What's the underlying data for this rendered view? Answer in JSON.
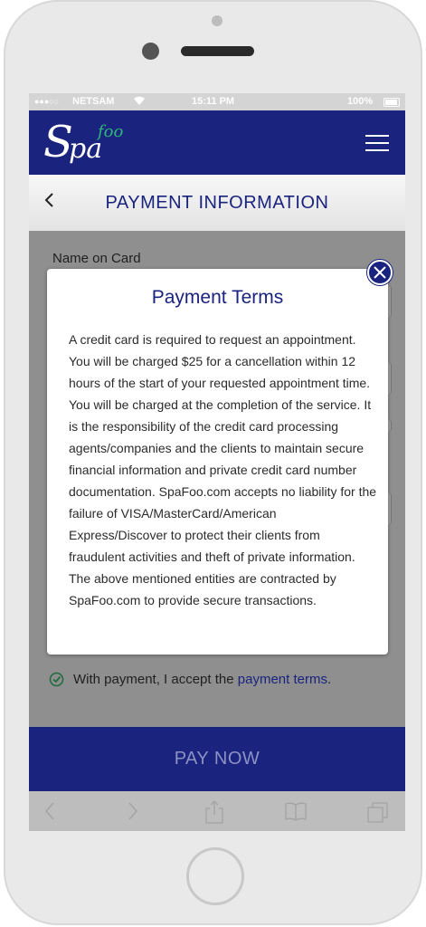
{
  "status_bar": {
    "signal": "●●●○○",
    "carrier": "NETSAM",
    "wifi_icon": "wifi-icon",
    "time": "15:11 PM",
    "battery": "100%"
  },
  "header": {
    "logo_s": "S",
    "logo_pa": "pa",
    "logo_foo": "foo",
    "menu_icon": "hamburger-menu-icon"
  },
  "titlebar": {
    "back_icon": "‹",
    "title": "PAYMENT INFORMATION"
  },
  "form": {
    "name_label": "Name on Card"
  },
  "modal": {
    "title": "Payment Terms",
    "body": "A credit card is required to request an appointment. You will be charged $25 for a cancellation within 12 hours of the start of your requested appointment time. You will be charged at the completion of the service. It is the responsibility of the credit card processing agents/companies and the clients to maintain secure financial information and private credit card number documentation. SpaFoo.com accepts no liability for the failure of VISA/MasterCard/American Express/Discover to protect their clients from fraudulent activities and theft of private information. The above mentioned entities are contracted by SpaFoo.com to provide secure transactions.",
    "close_icon": "close-icon"
  },
  "accept": {
    "text": "With payment, I accept the ",
    "link": "payment terms",
    "period": "."
  },
  "pay_button": {
    "label": "PAY NOW"
  },
  "browser": {
    "icons": [
      "back-arrow-icon",
      "forward-arrow-icon",
      "share-icon",
      "bookmarks-icon",
      "tabs-icon"
    ]
  },
  "colors": {
    "brand": "#1a237e",
    "accent_green": "#2fb67a",
    "overlay": "#8f8f8f"
  }
}
